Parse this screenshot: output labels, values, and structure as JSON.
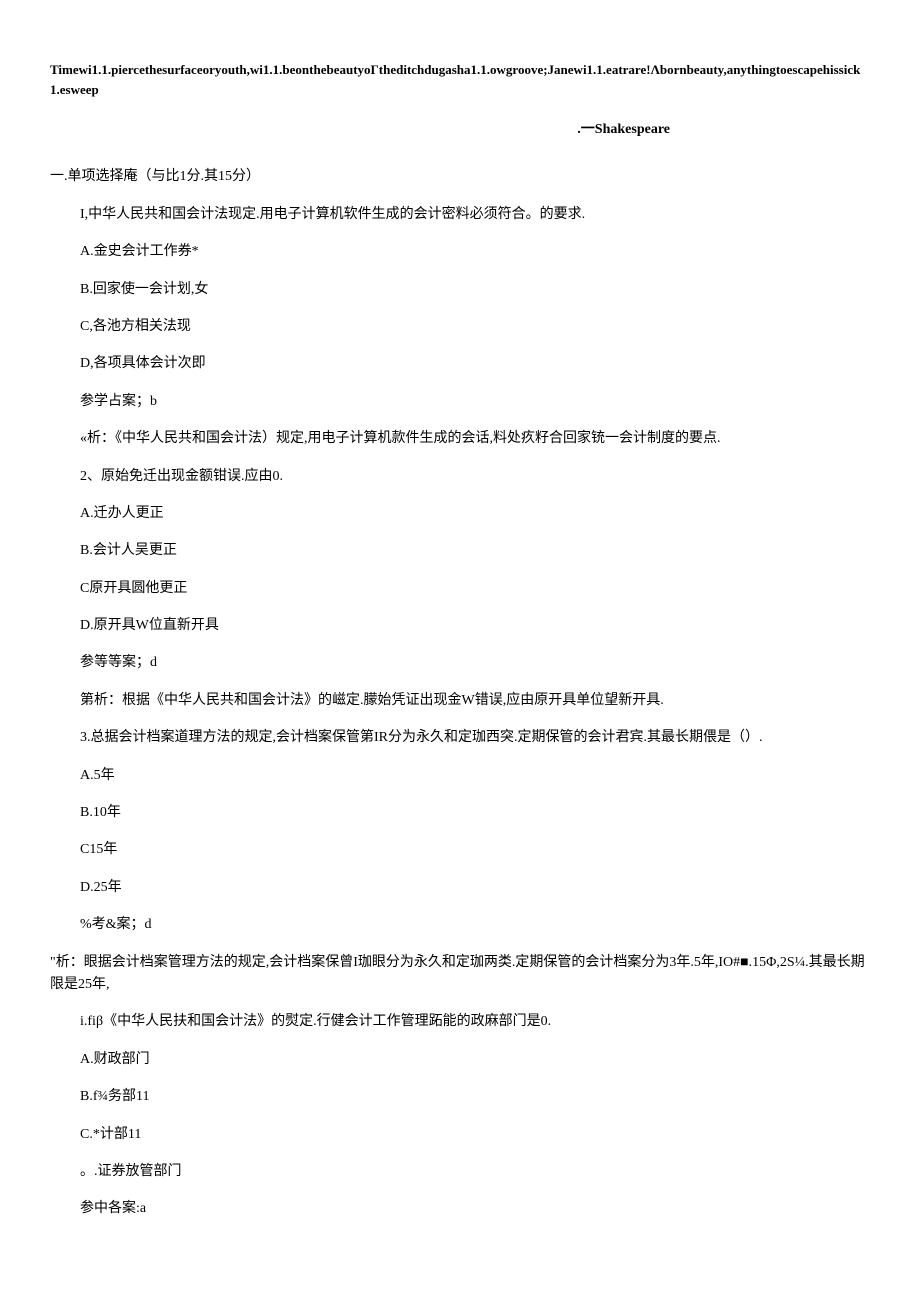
{
  "header": {
    "quote": "Timewi1.1.piercethesurfaceoryouth,wi1.1.beonthebeautyoΓtheditchdugasha1.1.owgroove;Janewi1.1.eatrare!Λbornbeauty,anythingtoescapehissick1.esweep",
    "attribution": ".一Shakespeare"
  },
  "section_title": "一.单项选择庵（与比1分.其15分）",
  "q1": {
    "stem": "I,中华人民共和国会计法现定.用电子计算机软件生成的会计密料必须符合。的要求.",
    "opt_a": "A.金史会计工作券*",
    "opt_b": "B.回家使一会计划,女",
    "opt_c": "C,各池方相关法现",
    "opt_d": "D,各项具体会计次即",
    "answer": "参学占案；b",
    "analysis": "«析：《中华人民共和国会计法）规定,用电子计算机款件生成的会话,料处疚籽合回家铳一会计制度的要点."
  },
  "q2": {
    "stem": "2、原始免迁出现金额钳误.应由0.",
    "opt_a": "A.迁办人更正",
    "opt_b": "B.会计人吴更正",
    "opt_c": "C原开具圆他更正",
    "opt_d": "D.原开具W位直新开具",
    "answer": "参等等案；d",
    "analysis": "第析：根据《中华人民共和国会计法》的嵫定.朦始凭证出现金W错误,应由原开具单位望新开具."
  },
  "q3": {
    "stem": "3.总据会计档案道理方法的规定,会计档案保管第IR分为永久和定珈西突.定期保管的会计君宾.其最长期偎是（）.",
    "opt_a": "A.5年",
    "opt_b": "B.10年",
    "opt_c": "C15年",
    "opt_d": "D.25年",
    "answer": "%考&案；d",
    "analysis": "\"析：眼据会计档案管理方法的规定,会计档案保曾I珈眼分为永久和定珈两类.定期保管的会计档案分为3年.5年,IO#■.15Φ,2S¼.其最长期限是25年,"
  },
  "q4": {
    "stem": "i.fiβ《中华人民扶和国会计法》的熨定.行健会计工作管理跖能的政麻部门是0.",
    "opt_a": "A.财政部门",
    "opt_b": "B.f¾务部11",
    "opt_c": "C.*计部11",
    "opt_d": "。.证券放管部门",
    "answer": "参中各案:a"
  }
}
